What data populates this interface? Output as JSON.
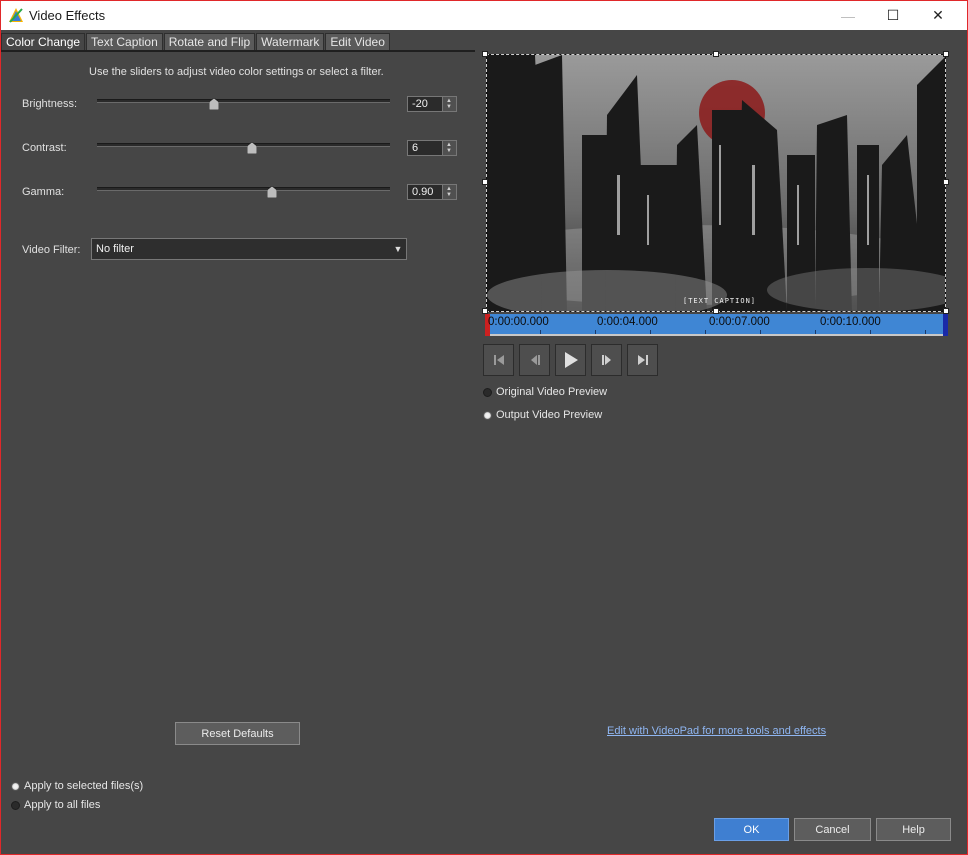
{
  "window": {
    "title": "Video Effects",
    "controls": {
      "minimize": "—",
      "maximize": "☐",
      "close": "✕"
    }
  },
  "tabs": [
    "Color Change",
    "Text Caption",
    "Rotate and Flip",
    "Watermark",
    "Edit Video"
  ],
  "active_tab": "Color Change",
  "instructions": "Use the sliders to adjust video color settings or select a filter.",
  "sliders": {
    "brightness": {
      "label": "Brightness:",
      "value": "-20",
      "min": -100,
      "max": 100
    },
    "contrast": {
      "label": "Contrast:",
      "value": "6",
      "min": -100,
      "max": 100
    },
    "gamma": {
      "label": "Gamma:",
      "value": "0.90",
      "min": 0.1,
      "max": 4.0
    }
  },
  "filter": {
    "label": "Video Filter:",
    "value": "No filter"
  },
  "reset_button": "Reset Defaults",
  "apply": {
    "selected": "Apply to selected files(s)",
    "all": "Apply to all files",
    "checked": "selected"
  },
  "preview": {
    "caption_overlay": "[TEXT CAPTION]",
    "timeline_labels": [
      "0:00:00.000",
      "0:00:04.000",
      "0:00:07.000",
      "0:00:10.000"
    ]
  },
  "transport": {
    "icons": [
      "skip-to-start-icon",
      "step-back-icon",
      "play-icon",
      "step-forward-icon",
      "skip-to-end-icon"
    ]
  },
  "preview_mode": {
    "original": "Original Video Preview",
    "output": "Output Video Preview",
    "checked": "output"
  },
  "link": "Edit with VideoPad for more tools and effects",
  "buttons": {
    "ok": "OK",
    "cancel": "Cancel",
    "help": "Help"
  },
  "colors": {
    "accent": "#3f7fd1",
    "window_border": "#e0282a",
    "panel": "#464646"
  }
}
